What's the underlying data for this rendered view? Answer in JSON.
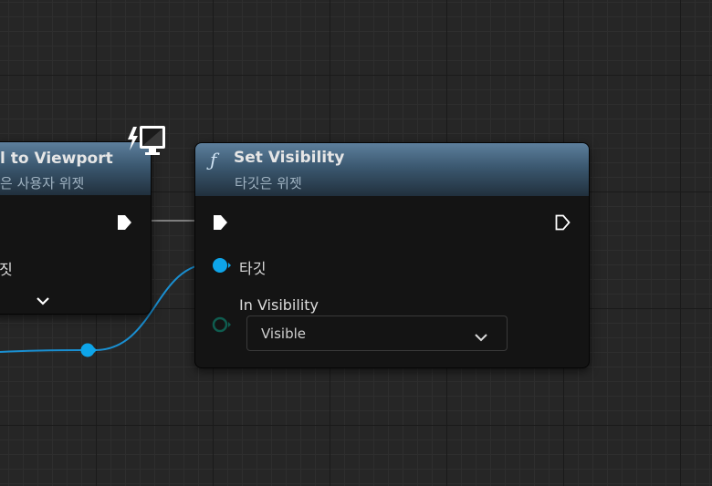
{
  "left_node": {
    "title": "l to Viewport",
    "subtitle": "은 사용자 위젯",
    "pin_label": "짓"
  },
  "set_visibility_node": {
    "title": "Set Visibility",
    "subtitle": "타깃은 위젯",
    "target_pin_label": "타깃",
    "visibility_pin_label": "In Visibility",
    "visibility_value": "Visible"
  },
  "colors": {
    "header_top": "#5d7f9c",
    "object_pin": "#0ea5e9",
    "enum_pin": "#0f5c4f",
    "exec_pin": "#ffffff"
  },
  "icons": {
    "function": "function-icon",
    "client_only": "client-only-icon",
    "exec": "exec-pin-icon",
    "chevron": "chevron-down-icon"
  }
}
